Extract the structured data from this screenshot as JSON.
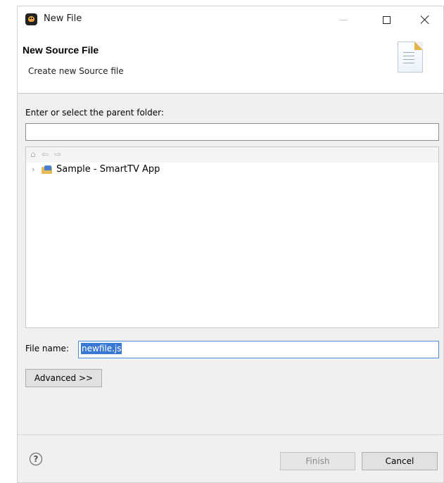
{
  "window": {
    "title": "New File",
    "controls": {
      "minimize": "minimize",
      "maximize": "maximize",
      "close": "close"
    }
  },
  "header": {
    "title": "New  Source File",
    "description": "Create new  Source file",
    "icon": "document-wizard-icon"
  },
  "form": {
    "parent_folder_label": "Enter or select the parent folder:",
    "parent_folder_value": "",
    "tree_toolbar_icons": [
      "home-icon",
      "back-arrow-icon",
      "forward-arrow-icon"
    ],
    "tree_items": [
      {
        "label": "Sample - SmartTV App",
        "expanded": false,
        "icon": "project-folder-icon"
      }
    ],
    "file_name_label": "File name:",
    "file_name_value": "newfile.js",
    "advanced_label": "Advanced >>"
  },
  "footer": {
    "help_symbol": "?",
    "finish_label": "Finish",
    "finish_enabled": false,
    "cancel_label": "Cancel"
  },
  "colors": {
    "selection": "#3a78d6",
    "dialog_background": "#f0f0f0",
    "focus_border": "#4a8ad8"
  }
}
